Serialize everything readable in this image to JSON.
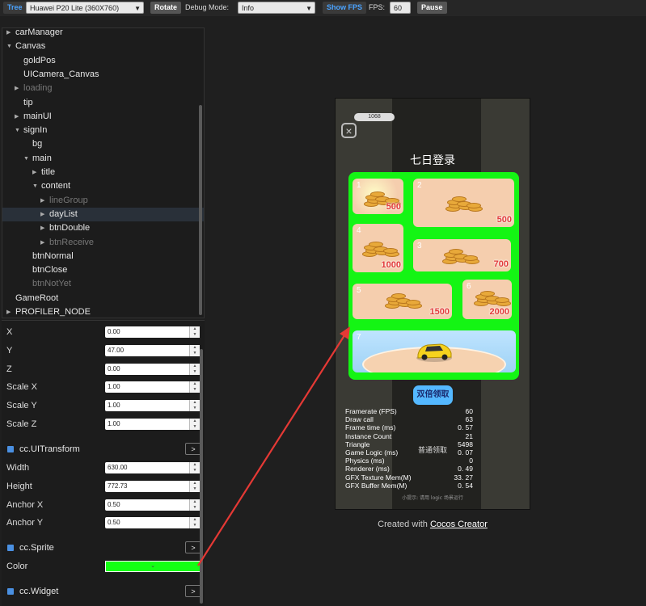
{
  "toolbar": {
    "tree_label": "Tree",
    "device": "Huawei P20 Lite (360X760)",
    "rotate_label": "Rotate",
    "debug_mode_label": "Debug Mode:",
    "debug_mode_value": "Info",
    "show_fps_label": "Show FPS",
    "fps_label": "FPS:",
    "fps_value": "60",
    "pause_label": "Pause"
  },
  "tree": {
    "items": [
      {
        "label": "carManager",
        "depth": 0,
        "caret": "right",
        "state": "normal"
      },
      {
        "label": "Canvas",
        "depth": 0,
        "caret": "down",
        "state": "normal"
      },
      {
        "label": "goldPos",
        "depth": 1,
        "caret": "none",
        "state": "normal"
      },
      {
        "label": "UICamera_Canvas",
        "depth": 1,
        "caret": "none",
        "state": "normal"
      },
      {
        "label": "loading",
        "depth": 1,
        "caret": "right",
        "state": "dim"
      },
      {
        "label": "tip",
        "depth": 1,
        "caret": "none",
        "state": "normal"
      },
      {
        "label": "mainUI",
        "depth": 1,
        "caret": "right",
        "state": "normal"
      },
      {
        "label": "signIn",
        "depth": 1,
        "caret": "down",
        "state": "normal"
      },
      {
        "label": "bg",
        "depth": 2,
        "caret": "none",
        "state": "normal"
      },
      {
        "label": "main",
        "depth": 2,
        "caret": "down",
        "state": "normal"
      },
      {
        "label": "title",
        "depth": 3,
        "caret": "right",
        "state": "normal"
      },
      {
        "label": "content",
        "depth": 3,
        "caret": "down",
        "state": "normal"
      },
      {
        "label": "lineGroup",
        "depth": 4,
        "caret": "right",
        "state": "dim"
      },
      {
        "label": "dayList",
        "depth": 4,
        "caret": "right",
        "state": "selected"
      },
      {
        "label": "btnDouble",
        "depth": 4,
        "caret": "right",
        "state": "normal"
      },
      {
        "label": "btnReceive",
        "depth": 4,
        "caret": "right",
        "state": "dim"
      },
      {
        "label": "btnNormal",
        "depth": 2,
        "caret": "none",
        "state": "normal"
      },
      {
        "label": "btnClose",
        "depth": 2,
        "caret": "none",
        "state": "normal"
      },
      {
        "label": "btnNotYet",
        "depth": 2,
        "caret": "none",
        "state": "dim"
      },
      {
        "label": "GameRoot",
        "depth": 0,
        "caret": "none",
        "state": "normal"
      },
      {
        "label": "PROFILER_NODE",
        "depth": 0,
        "caret": "right",
        "state": "normal"
      }
    ]
  },
  "props": {
    "transform": [
      {
        "label": "X",
        "value": "0.00"
      },
      {
        "label": "Y",
        "value": "47.00"
      },
      {
        "label": "Z",
        "value": "0.00"
      },
      {
        "label": "Scale X",
        "value": "1.00"
      },
      {
        "label": "Scale Y",
        "value": "1.00"
      },
      {
        "label": "Scale Z",
        "value": "1.00"
      }
    ],
    "ui_transform": {
      "title": "cc.UITransform",
      "button": ">",
      "fields": [
        {
          "label": "Width",
          "value": "630.00"
        },
        {
          "label": "Height",
          "value": "772.73"
        },
        {
          "label": "Anchor X",
          "value": "0.50"
        },
        {
          "label": "Anchor Y",
          "value": "0.50"
        }
      ]
    },
    "sprite": {
      "title": "cc.Sprite",
      "button": ">",
      "color_label": "Color",
      "color_value": "#14ff14"
    },
    "widget": {
      "title": "cc.Widget",
      "button": ">"
    }
  },
  "preview": {
    "coin_count": "1068",
    "title": "七日登录",
    "days": [
      {
        "num": "1",
        "amount": "500"
      },
      {
        "num": "2",
        "amount": "500"
      },
      {
        "num": "4",
        "amount": "1000"
      },
      {
        "num": "3",
        "amount": "700"
      },
      {
        "num": "5",
        "amount": "1500"
      },
      {
        "num": "6",
        "amount": "2000"
      },
      {
        "num": "7",
        "amount": ""
      }
    ],
    "double_button": "双倍领取",
    "normal_button": "普通领取",
    "hint": "小提示: 请用 logic 场景运行",
    "stats": [
      {
        "label": "Framerate (FPS)",
        "value": "60"
      },
      {
        "label": "Draw call",
        "value": "63"
      },
      {
        "label": "Frame time (ms)",
        "value": "0. 57"
      },
      {
        "label": "Instance Count",
        "value": "21"
      },
      {
        "label": "Triangle",
        "value": "5498"
      },
      {
        "label": "Game Logic (ms)",
        "value": "0. 07"
      },
      {
        "label": "Physics (ms)",
        "value": "0"
      },
      {
        "label": "Renderer (ms)",
        "value": "0. 49"
      },
      {
        "label": "GFX Texture Mem(M)",
        "value": "33. 27"
      },
      {
        "label": "GFX Buffer Mem(M)",
        "value": "0. 54"
      }
    ],
    "accent_green": "#14f514",
    "annotation_color": "#e53935"
  },
  "credit": {
    "prefix": "Created with ",
    "link": "Cocos Creator"
  }
}
